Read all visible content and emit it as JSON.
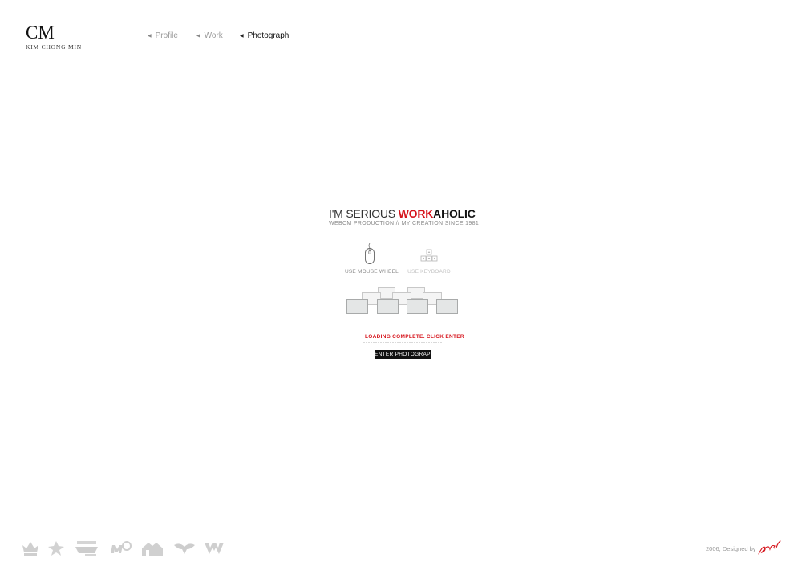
{
  "logo": {
    "mark": "CM",
    "name": "KIM CHONG MIN"
  },
  "nav": {
    "items": [
      {
        "label": "Profile",
        "active": false
      },
      {
        "label": "Work",
        "active": false
      },
      {
        "label": "Photograph",
        "active": true
      }
    ]
  },
  "intro": {
    "headline_start": "I'M SERIOUS ",
    "headline_red": "WORK",
    "headline_bold": "AHOLIC",
    "tagline": "WEBCM PRODUCTION // MY CREATION SINCE 1981"
  },
  "controls": {
    "mouse": {
      "icon": "mouse-icon",
      "label": "USE MOUSE WHEEL"
    },
    "keyboard": {
      "icon": "keyboard-arrows-icon",
      "label": "USE KEYBOARD"
    }
  },
  "loading": {
    "message": "LOADING COMPLETE. CLICK ENTER",
    "progress": 1.0,
    "enter_label": "ENTER PHOTOGRAPH"
  },
  "footer": {
    "badges": [
      "crown-award-icon",
      "leaf-award-icon",
      "nominate-award-icon",
      "mp-award-icon",
      "house-award-icon",
      "wings-award-icon",
      "w-award-icon"
    ],
    "credit": "2006, Designed by",
    "signature_icon": "signature-icon"
  },
  "colors": {
    "accent": "#d6141c",
    "muted": "#9a9a9a",
    "ink": "#111111"
  }
}
